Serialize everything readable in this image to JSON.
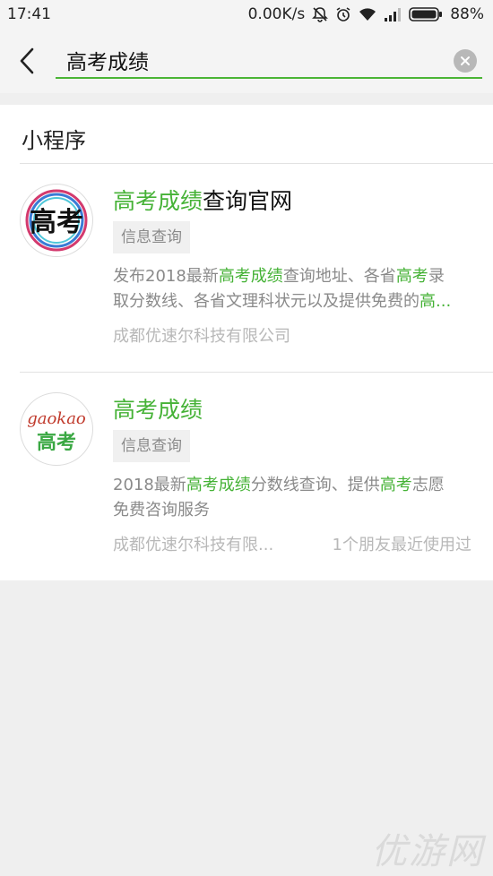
{
  "status_bar": {
    "time": "17:41",
    "net_speed": "0.00K/s",
    "battery": "88%",
    "battery_level": 0.88
  },
  "search": {
    "query": "高考成绩",
    "back_icon": "chevron-left-icon",
    "clear_icon": "clear-icon"
  },
  "section": {
    "title": "小程序"
  },
  "results": [
    {
      "title_hl": "高考成绩",
      "title_rest": "查询官网",
      "tag": "信息查询",
      "desc_line1": {
        "a": "发布2018最新",
        "b": "高考成绩",
        "c": "查询地址、各省",
        "d": "高考",
        "e": "录"
      },
      "desc_line2": {
        "a": "取分数线、各省文理科状元以及提供免费的",
        "b": "高..."
      },
      "company": "成都优速尔科技有限公司",
      "logo_text": "高考"
    },
    {
      "title_hl": "高考成绩",
      "tag": "信息查询",
      "desc_line1": {
        "a": "2018最新",
        "b": "高考成绩",
        "c": "分数线查询、提供",
        "d": "高考",
        "e": "志愿"
      },
      "desc_line2": {
        "a": "免费咨询服务"
      },
      "company": "成都优速尔科技有限...",
      "friends": "1个朋友最近使用过",
      "logo_text_en": "gaokao",
      "logo_text_cn": "高考"
    }
  ],
  "watermark": "优游网",
  "colors": {
    "accent": "#45b236",
    "underline": "#4bb535",
    "muted": "#8a8a8a",
    "light_muted": "#b8b8b8"
  }
}
